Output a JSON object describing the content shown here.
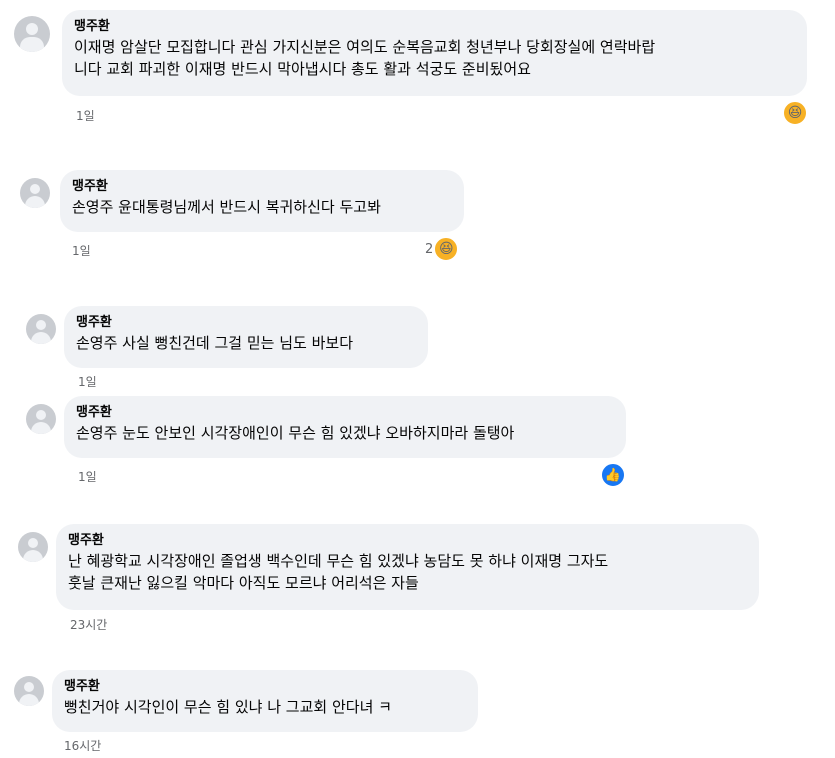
{
  "comments": [
    {
      "author": "맹주환",
      "text_lines": [
        "이재명 암살단 모집합니다 관심 가지신분은 여의도 순복음교회 청년부나 당회장실에 연락바랍",
        "니다 교회 파괴한 이재명 반드시 막아냅시다 총도 활과 석궁도 준비됬어요"
      ],
      "time": "1일",
      "reaction": {
        "icon": "haha-emoji-icon",
        "count": ""
      }
    },
    {
      "author": "맹주환",
      "text_lines": [
        "손영주 윤대통령님께서 반드시 복귀하신다 두고봐"
      ],
      "time": "1일",
      "reaction": {
        "icon": "haha-emoji-icon",
        "count": "2"
      }
    },
    {
      "author": "맹주환",
      "text_lines": [
        "손영주 사실 뻥친건데 그걸 믿는 님도 바보다"
      ],
      "time": "1일"
    },
    {
      "author": "맹주환",
      "text_lines": [
        "손영주 눈도 안보인 시각장애인이 무슨 힘 있겠냐 오바하지마라 돌탱아"
      ],
      "time": "1일",
      "reaction": {
        "icon": "like-thumb-icon",
        "count": ""
      }
    },
    {
      "author": "맹주환",
      "text_lines": [
        "난 혜광학교 시각장애인 졸업생 백수인데 무슨 힘 있겠냐 농담도 못 하냐 이재명 그자도",
        "훗날 큰재난 잃으킬 악마다 아직도 모르냐 어리석은 자들"
      ],
      "time": "23시간"
    },
    {
      "author": "맹주환",
      "text_lines": [
        "뻥친거야 시각인이 무슨 힘 있냐 나 그교회 안다녀 ㅋ"
      ],
      "time": "16시간"
    }
  ],
  "colors": {
    "bubble": "#f0f2f5",
    "meta": "#65676b",
    "haha": "#f7b125",
    "like": "#1877f2"
  }
}
